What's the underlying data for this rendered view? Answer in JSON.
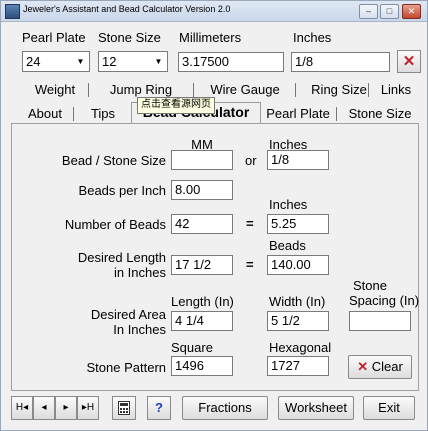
{
  "window": {
    "title": "Jeweler's Assistant and Bead Calculator Version 2.0",
    "min": "–",
    "max": "□",
    "close": "✕"
  },
  "top": {
    "pearl_plate_label": "Pearl Plate",
    "pearl_plate_value": "24",
    "stone_size_label": "Stone Size",
    "stone_size_value": "12",
    "mm_label": "Millimeters",
    "mm_value": "3.17500",
    "inches_label": "Inches",
    "inches_value": "1/8",
    "clear_x": "✕"
  },
  "tabs_row1": [
    "Weight",
    "Jump Ring",
    "Wire Gauge",
    "Ring Size",
    "Links"
  ],
  "tabs_row2": [
    "About",
    "Tips",
    "Bead Calculator",
    "Pearl Plate",
    "Stone Size"
  ],
  "tooltip": "点击查看源网页",
  "panel": {
    "mm_header": "MM",
    "inches_header": "Inches",
    "bead_stone_size_label": "Bead / Stone Size",
    "bead_stone_size_mm": "",
    "or_text": "or",
    "bead_stone_size_in": "1/8",
    "beads_per_inch_label": "Beads per Inch",
    "beads_per_inch_value": "8.00",
    "inches_header2": "Inches",
    "number_of_beads_label": "Number of Beads",
    "number_of_beads_value": "42",
    "eq1": "=",
    "number_of_beads_inches": "5.25",
    "beads_header": "Beads",
    "desired_length_label_1": "Desired Length",
    "desired_length_label_2": "in Inches",
    "desired_length_value": "17 1/2",
    "eq2": "=",
    "desired_length_beads": "140.00",
    "length_header": "Length (In)",
    "width_header": "Width (In)",
    "stone_spacing_header_1": "Stone",
    "stone_spacing_header_2": "Spacing (In)",
    "desired_area_label_1": "Desired Area",
    "desired_area_label_2": "In Inches",
    "length_value": "4 1/4",
    "width_value": "5 1/2",
    "stone_spacing_value": "",
    "square_header": "Square",
    "hexagonal_header": "Hexagonal",
    "stone_pattern_label": "Stone Pattern",
    "square_value": "1496",
    "hexagonal_value": "1727",
    "clear_label": "Clear",
    "clear_icon": "✕"
  },
  "bottom": {
    "first": "H◂",
    "prev": "◂",
    "next": "▸",
    "last": "▸H",
    "calculator_icon": "calculator-icon",
    "help": "?",
    "fractions": "Fractions",
    "worksheet": "Worksheet",
    "exit": "Exit"
  },
  "colors": {
    "accent_red": "#c0202a",
    "help_blue": "#1a3fbf"
  }
}
